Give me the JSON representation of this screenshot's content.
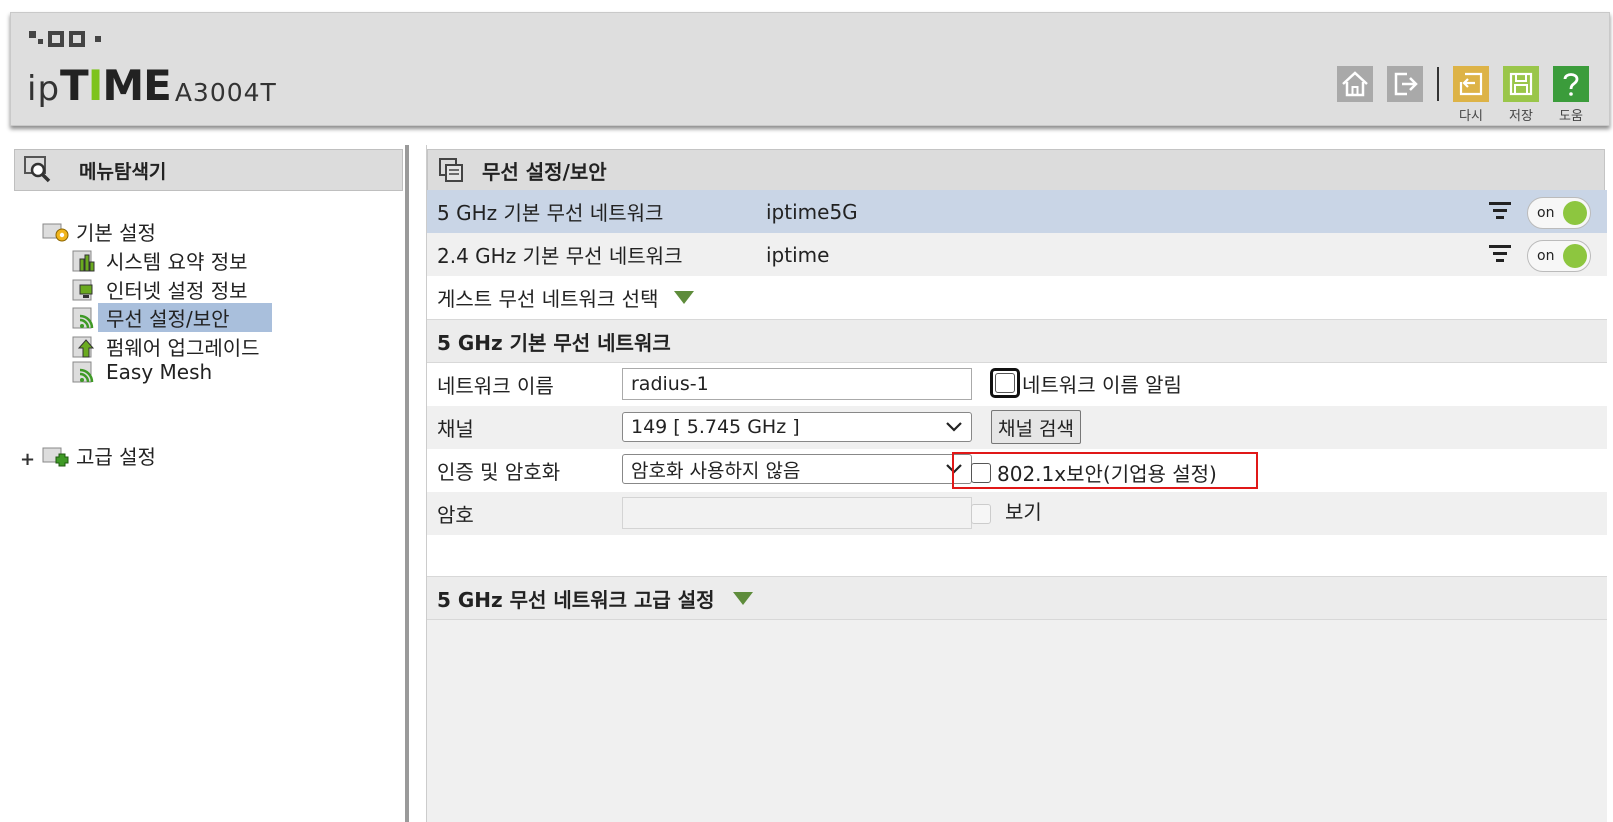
{
  "header": {
    "brand_ip": "ip",
    "brand_time": "TIME",
    "model": "A3004T",
    "buttons": {
      "home_label": "",
      "logout_label": "",
      "refresh_caption": "다시",
      "save_caption": "저장",
      "help_caption": "도움"
    }
  },
  "sidebar": {
    "finder_title": "메뉴탐색기",
    "basic": {
      "label": "기본 설정",
      "items": [
        {
          "label": "시스템 요약 정보"
        },
        {
          "label": "인터넷 설정 정보"
        },
        {
          "label": "무선 설정/보안"
        },
        {
          "label": "펌웨어 업그레이드"
        },
        {
          "label": "Easy Mesh"
        }
      ]
    },
    "advanced": {
      "label": "고급 설정",
      "expander": "+"
    }
  },
  "main": {
    "title": "무선 설정/보안",
    "networks": [
      {
        "label": "5 GHz 기본 무선 네트워크",
        "ssid": "iptime5G",
        "toggle": "on"
      },
      {
        "label": "2.4 GHz 기본 무선 네트워크",
        "ssid": "iptime",
        "toggle": "on"
      }
    ],
    "guest_select": "게스트 무선 네트워크 선택",
    "section_basic": "5 GHz 기본 무선 네트워크",
    "form": {
      "name_label": "네트워크 이름",
      "name_value": "radius-1",
      "name_broadcast_label": "네트워크 이름 알림",
      "channel_label": "채널",
      "channel_value": "149 [ 5.745 GHz ]",
      "channel_search": "채널 검색",
      "auth_label": "인증 및 암호화",
      "auth_value": "암호화 사용하지 않음",
      "enterprise_label": "802.1x보안(기업용 설정)",
      "password_label": "암호",
      "password_value": "",
      "show_label": "보기"
    },
    "section_advanced": "5 GHz 무선 네트워크 고급 설정"
  },
  "colors": {
    "accent_green": "#7ec31d",
    "selected_row": "#c9d5e6",
    "sidebar_selected": "#a9bfdc",
    "toggle_on": "#8dc63f",
    "highlight_red": "#e01818"
  }
}
